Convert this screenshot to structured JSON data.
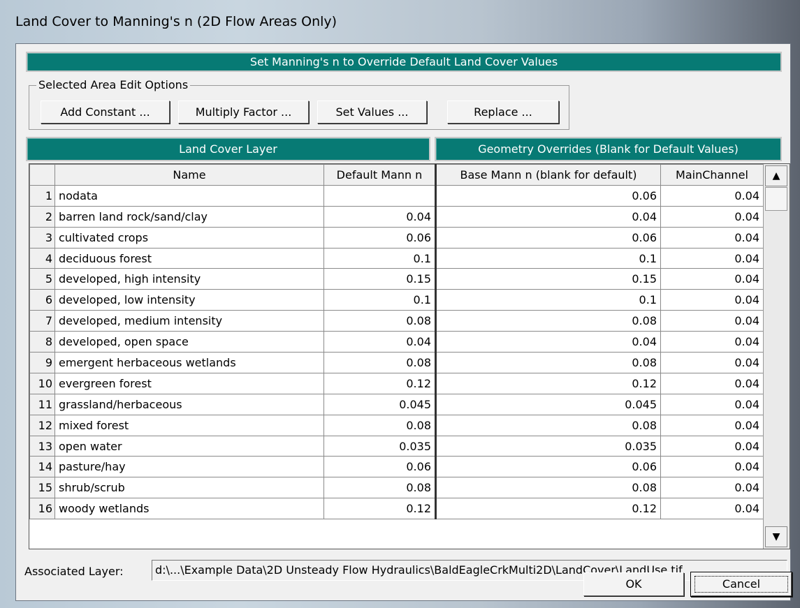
{
  "window": {
    "title": "Land Cover to Manning's n (2D Flow Areas Only)"
  },
  "header": {
    "title": "Set Manning's n to Override Default Land Cover Values"
  },
  "edit_options": {
    "label": "Selected Area Edit Options",
    "buttons": [
      "Add Constant ...",
      "Multiply Factor ...",
      "Set Values ...",
      "Replace ..."
    ]
  },
  "sections": {
    "land_cover": "Land Cover Layer",
    "overrides": "Geometry Overrides (Blank for Default Values)"
  },
  "table": {
    "columns": [
      "Name",
      "Default Mann n",
      "Base Mann n (blank for default)",
      "MainChannel"
    ],
    "rows": [
      {
        "num": "1",
        "name": "nodata",
        "default": "",
        "base": "0.06",
        "main": "0.04"
      },
      {
        "num": "2",
        "name": "barren land rock/sand/clay",
        "default": "0.04",
        "base": "0.04",
        "main": "0.04"
      },
      {
        "num": "3",
        "name": "cultivated crops",
        "default": "0.06",
        "base": "0.06",
        "main": "0.04"
      },
      {
        "num": "4",
        "name": "deciduous forest",
        "default": "0.1",
        "base": "0.1",
        "main": "0.04"
      },
      {
        "num": "5",
        "name": "developed, high intensity",
        "default": "0.15",
        "base": "0.15",
        "main": "0.04"
      },
      {
        "num": "6",
        "name": "developed, low intensity",
        "default": "0.1",
        "base": "0.1",
        "main": "0.04"
      },
      {
        "num": "7",
        "name": "developed, medium intensity",
        "default": "0.08",
        "base": "0.08",
        "main": "0.04"
      },
      {
        "num": "8",
        "name": "developed, open space",
        "default": "0.04",
        "base": "0.04",
        "main": "0.04"
      },
      {
        "num": "9",
        "name": "emergent herbaceous wetlands",
        "default": "0.08",
        "base": "0.08",
        "main": "0.04"
      },
      {
        "num": "10",
        "name": "evergreen forest",
        "default": "0.12",
        "base": "0.12",
        "main": "0.04"
      },
      {
        "num": "11",
        "name": "grassland/herbaceous",
        "default": "0.045",
        "base": "0.045",
        "main": "0.04"
      },
      {
        "num": "12",
        "name": "mixed forest",
        "default": "0.08",
        "base": "0.08",
        "main": "0.04"
      },
      {
        "num": "13",
        "name": "open water",
        "default": "0.035",
        "base": "0.035",
        "main": "0.04"
      },
      {
        "num": "14",
        "name": "pasture/hay",
        "default": "0.06",
        "base": "0.06",
        "main": "0.04"
      },
      {
        "num": "15",
        "name": "shrub/scrub",
        "default": "0.08",
        "base": "0.08",
        "main": "0.04"
      },
      {
        "num": "16",
        "name": "woody wetlands",
        "default": "0.12",
        "base": "0.12",
        "main": "0.04"
      }
    ]
  },
  "scrollbar": {
    "up_icon": "▲",
    "down_icon": "▼"
  },
  "associated_layer": {
    "label": "Associated Layer:",
    "value": "d:\\...\\Example Data\\2D Unsteady Flow Hydraulics\\BaldEagleCrkMulti2D\\LandCover\\LandUse.tif"
  },
  "footer": {
    "ok": "OK",
    "cancel": "Cancel"
  },
  "colors": {
    "header_bg": "#077a74",
    "dialog_bg": "#f0f0f0"
  }
}
